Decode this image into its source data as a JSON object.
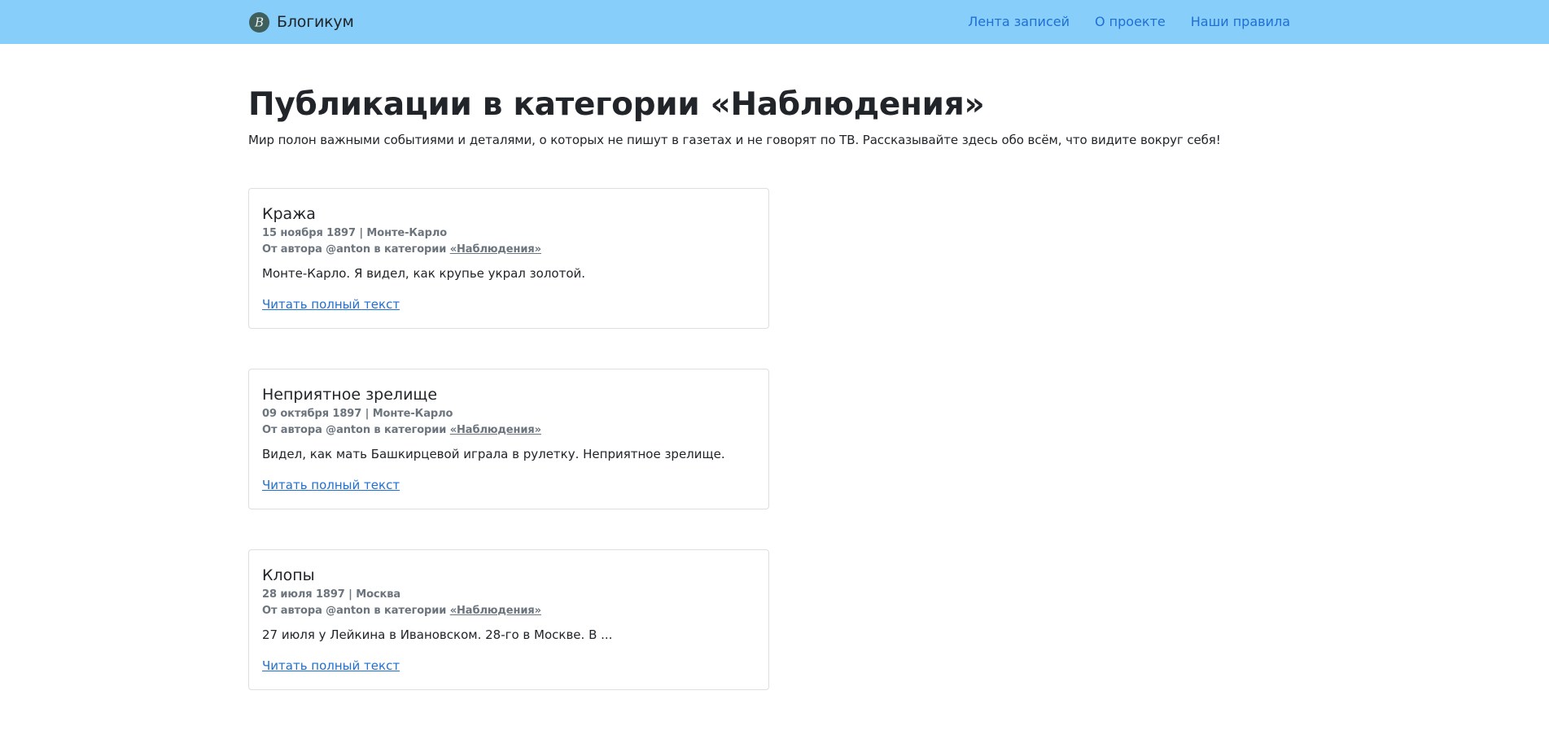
{
  "navbar": {
    "brand_name": "Блогикум",
    "brand_logo_icon": "blogicum-logo-icon",
    "background_color": "#87cefa",
    "links": [
      {
        "label": "Лента записей"
      },
      {
        "label": "О проекте"
      },
      {
        "label": "Наши правила"
      }
    ]
  },
  "page": {
    "title": "Публикации в категории «Наблюдения»",
    "description": "Мир полон важными событиями и деталями, о которых не пишут в газетах и не говорят по ТВ. Рассказывайте здесь обо всём, что видите вокруг себя!"
  },
  "posts": [
    {
      "title": "Кража",
      "date_location": "15 ноября 1897 | Монте-Карло",
      "author_prefix": "От автора @anton в категории ",
      "category": "«Наблюдения»",
      "excerpt": "Монте-Карло. Я видел, как крупье украл золотой.",
      "read_more": "Читать полный текст"
    },
    {
      "title": "Неприятное зрелище",
      "date_location": "09 октября 1897 | Монте-Карло",
      "author_prefix": "От автора @anton в категории ",
      "category": "«Наблюдения»",
      "excerpt": "Видел, как мать Башкирцевой играла в рулетку. Неприятное зрелище.",
      "read_more": "Читать полный текст"
    },
    {
      "title": "Клопы",
      "date_location": "28 июля 1897 | Москва",
      "author_prefix": "От автора @anton в категории ",
      "category": "«Наблюдения»",
      "excerpt": "27 июля у Лейкина в Ивановском. 28-го в Москве. В ...",
      "read_more": "Читать полный текст"
    }
  ],
  "colors": {
    "link": "#1f6fd4",
    "muted": "#6c757d",
    "text": "#212529"
  }
}
